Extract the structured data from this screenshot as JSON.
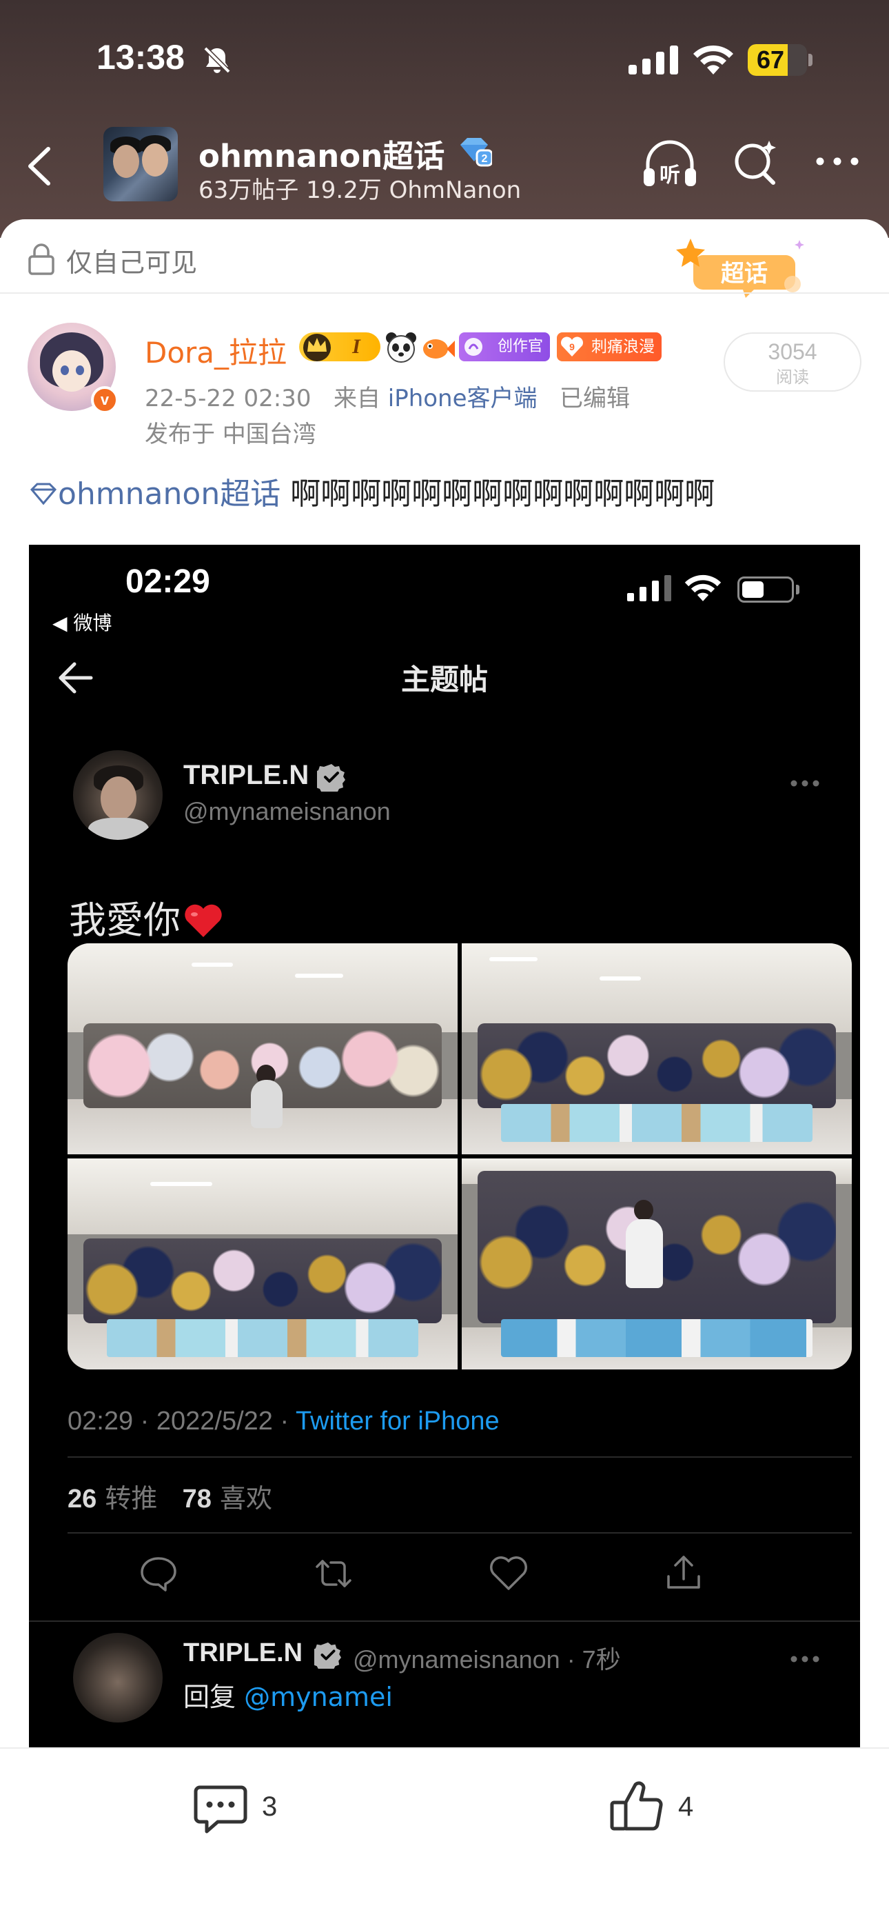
{
  "status_bar": {
    "time": "13:38",
    "battery": "67",
    "battery_level": 0.67
  },
  "header": {
    "topic_title": "ohmnanon超话",
    "topic_stats": "63万帖子 19.2万 OhmNanon",
    "icons": [
      "back-icon",
      "listen-icon",
      "search-icon",
      "more-icon"
    ]
  },
  "card": {
    "visibility": "仅自己可见",
    "supertopic_tag": "超话"
  },
  "author": {
    "name": "Dora_拉拉",
    "level_badge": "I",
    "creator_badge": "创作官",
    "fan_badge": "刺痛浪漫",
    "datetime": "22-5-22 02:30",
    "from_prefix": "来自",
    "client": "iPhone客户端",
    "edited": "已编辑",
    "location": "发布于 中国台湾",
    "vip_mark": "v"
  },
  "read": {
    "count": "3054",
    "label": "阅读"
  },
  "post": {
    "topic_link": "ohmnanon超话",
    "body": "啊啊啊啊啊啊啊啊啊啊啊啊啊啊"
  },
  "embed": {
    "status_time": "02:29",
    "back_app": "◀ 微博",
    "battery_level": 0.45,
    "page_title": "主题帖",
    "name": "TRIPLE.N",
    "handle": "@mynameisnanon",
    "tweet_text": "我愛你",
    "footer_time": "02:29 · 2022/5/22 · ",
    "footer_source": "Twitter for iPhone",
    "retweets_count": "26",
    "retweets_label": "转推",
    "likes_count": "78",
    "likes_label": "喜欢",
    "reply_name": "TRIPLE.N",
    "reply_handle": "@mynameisnanon · 7秒",
    "reply_prefix": "回复 ",
    "reply_mention": "@mynamei"
  },
  "bottom_bar": {
    "comments": "3",
    "likes": "4"
  },
  "colors": {
    "header_bg": "#4d3c3a",
    "author_orange": "#f26f21",
    "link_blue": "#4f6fa8",
    "twitter_blue": "#1d9bf0",
    "battery_yellow": "#f6d51e"
  }
}
